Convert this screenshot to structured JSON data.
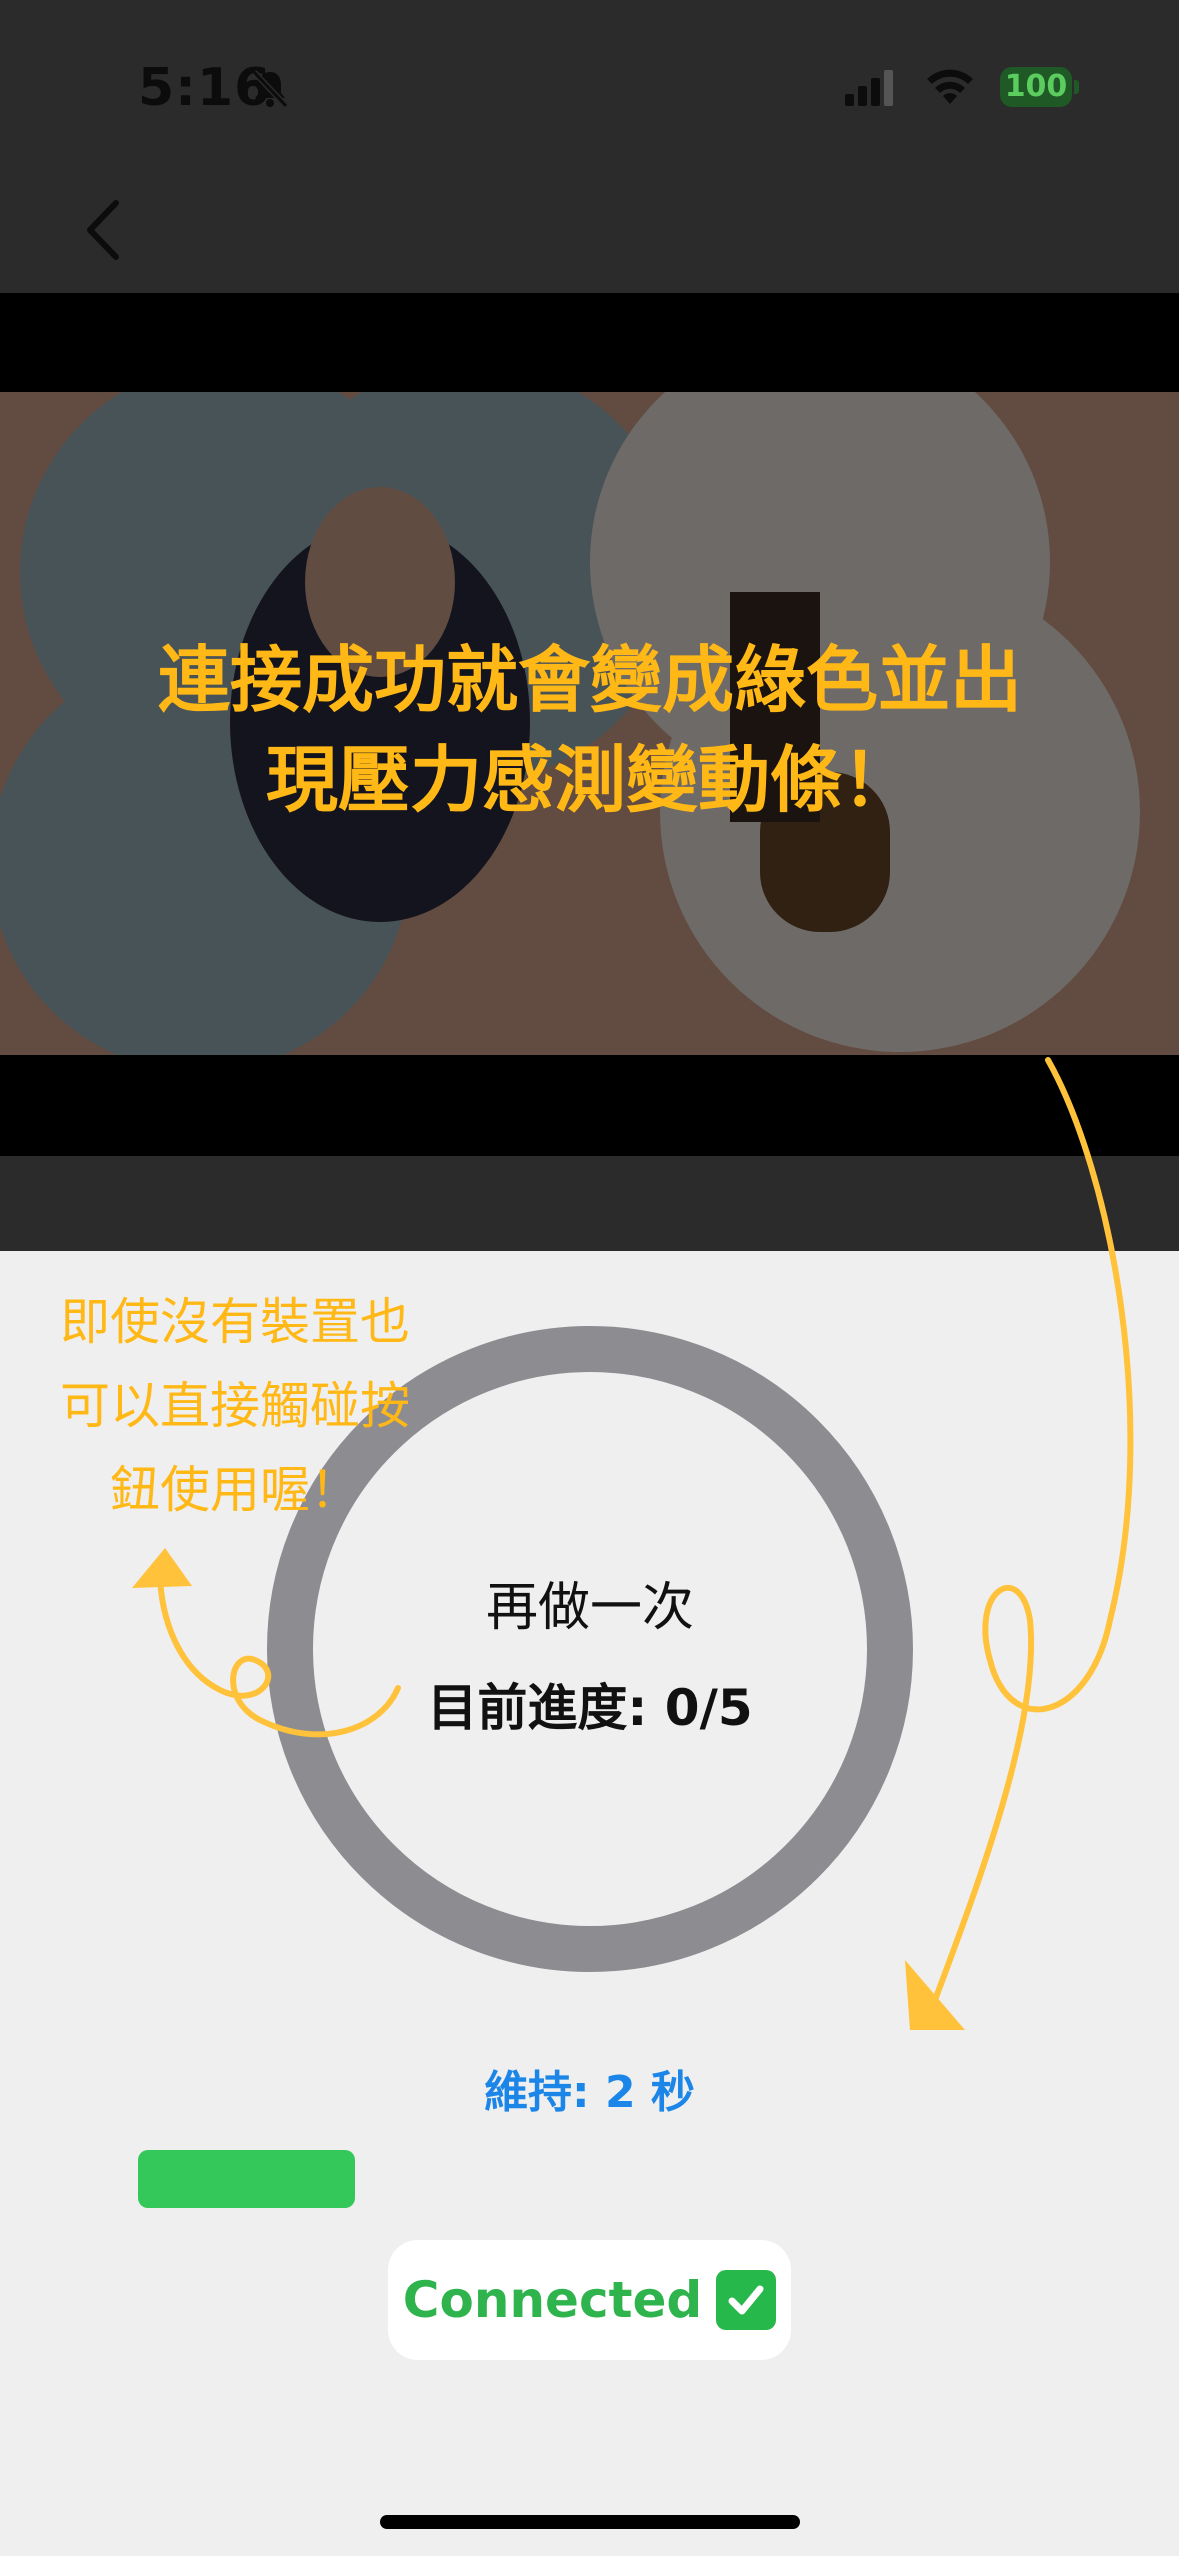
{
  "status_bar": {
    "time": "5:16",
    "battery": "100",
    "icons": [
      "bell-slash-icon",
      "cellular-signal-icon",
      "wifi-icon",
      "battery-icon"
    ]
  },
  "nav": {
    "back_icon": "chevron-left-icon"
  },
  "video": {
    "overlay_caption": "連接成功就會變成綠色並出現壓力感測變動條！",
    "colors": {
      "caption": "#ffb816"
    }
  },
  "exercise": {
    "button_label": "再做一次",
    "progress_text": "目前進度: 0/5",
    "progress_done": 0,
    "progress_total": 5
  },
  "side_note": "即使沒有裝置也可以直接觸碰按鈕使用喔！",
  "hold": {
    "label": "維持: 2 秒",
    "pressure_level": 0.62
  },
  "connection": {
    "status_text": "Connected",
    "icon": "check-mark-button-icon"
  },
  "colors": {
    "accent_blue": "#1c86e8",
    "bar_green": "#34c759",
    "annotation_orange": "#ffb816",
    "ring_gray": "#8d8d91"
  }
}
